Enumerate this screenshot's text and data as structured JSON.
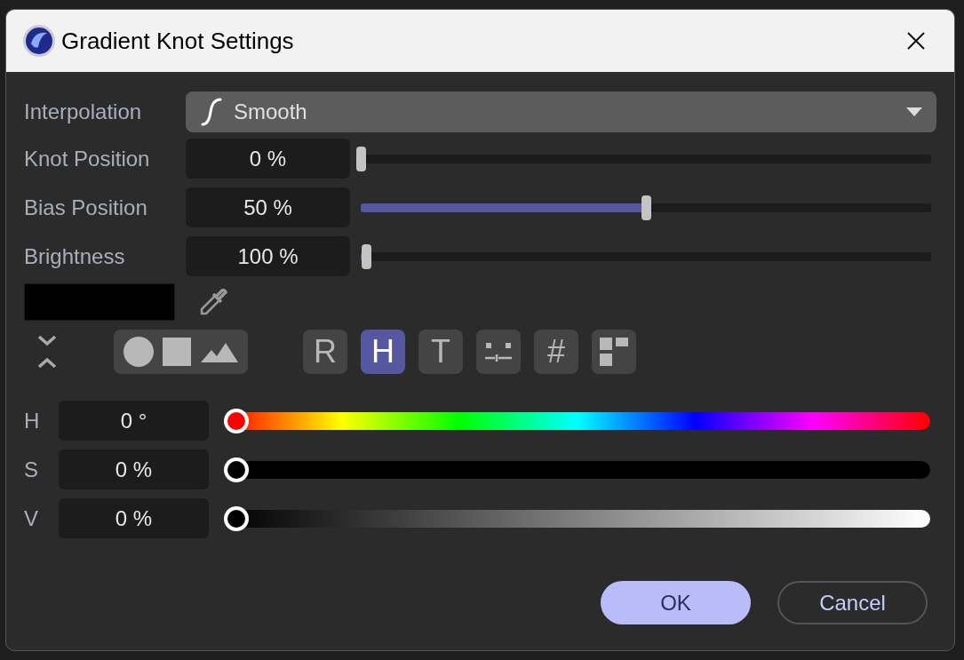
{
  "window": {
    "title": "Gradient Knot Settings"
  },
  "interpolation": {
    "label": "Interpolation",
    "value": "Smooth"
  },
  "sliders": [
    {
      "label": "Knot Position",
      "value": "0 %",
      "level": 0
    },
    {
      "label": "Bias Position",
      "value": "50 %",
      "level": 0.5
    },
    {
      "label": "Brightness",
      "value": "100 %",
      "level": 0.01
    }
  ],
  "swatch": {
    "color": "#000000"
  },
  "modes": [
    {
      "kind": "text",
      "label": "R",
      "selected": false
    },
    {
      "kind": "text",
      "label": "H",
      "selected": true
    },
    {
      "kind": "text",
      "label": "T",
      "selected": false
    },
    {
      "kind": "mixer",
      "selected": false
    },
    {
      "kind": "text",
      "label": "#",
      "selected": false
    },
    {
      "kind": "swatches",
      "selected": false
    }
  ],
  "channels": [
    {
      "kind": "hue",
      "label": "H",
      "value": "0 °",
      "level": 0
    },
    {
      "kind": "saturation",
      "label": "S",
      "value": "0 %",
      "level": 0
    },
    {
      "kind": "value",
      "label": "V",
      "value": "0 %",
      "level": 0
    }
  ],
  "buttons": [
    {
      "label": "OK",
      "primary": true
    },
    {
      "label": "Cancel",
      "primary": false
    }
  ]
}
